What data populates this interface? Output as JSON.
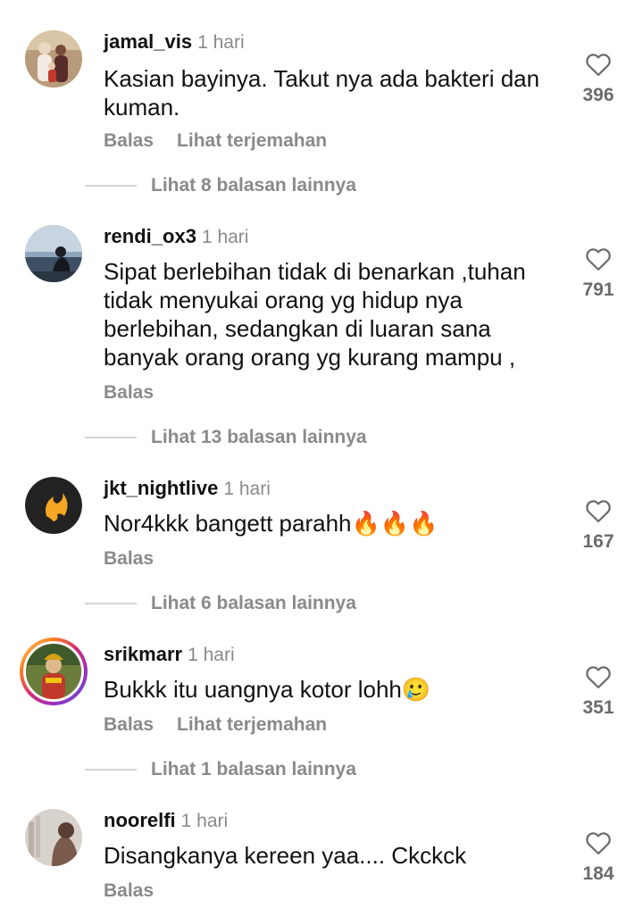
{
  "common": {
    "reply_label": "Balas",
    "translate_label": "Lihat terjemahan"
  },
  "comments": [
    {
      "username": "jamal_vis",
      "time": "1 hari",
      "text": "Kasian bayinya. Takut nya ada bakteri dan kuman.",
      "likes": "396",
      "replies_label": "Lihat 8 balasan lainnya"
    },
    {
      "username": "rendi_ox3",
      "time": "1 hari",
      "text": "Sipat berlebihan tidak di benarkan ,tuhan tidak menyukai orang yg hidup nya berlebihan, sedangkan di luaran sana banyak orang orang yg kurang mampu ,",
      "likes": "791",
      "replies_label": "Lihat 13 balasan lainnya"
    },
    {
      "username": "jkt_nightlive",
      "time": "1 hari",
      "text": "Nor4kkk bangett parahh🔥🔥🔥",
      "likes": "167",
      "replies_label": "Lihat 6 balasan lainnya"
    },
    {
      "username": "srikmarr",
      "time": "1 hari",
      "text": "Bukkk itu uangnya kotor lohh🥲",
      "likes": "351",
      "replies_label": "Lihat 1 balasan lainnya"
    },
    {
      "username": "noorelfi",
      "time": "1 hari",
      "text": "Disangkanya kereen yaa.... Ckckck",
      "likes": "184"
    }
  ],
  "icons": {
    "like": "heart-outline-icon",
    "flame": "fire-emoji",
    "sad": "crying-face-emoji"
  },
  "colors": {
    "secondary_text": "#8a8a8a",
    "divider": "#d4d4d4",
    "story_ring": [
      "#feda75",
      "#fa7e1e",
      "#d62976",
      "#962fbf",
      "#4f5bd5"
    ]
  }
}
